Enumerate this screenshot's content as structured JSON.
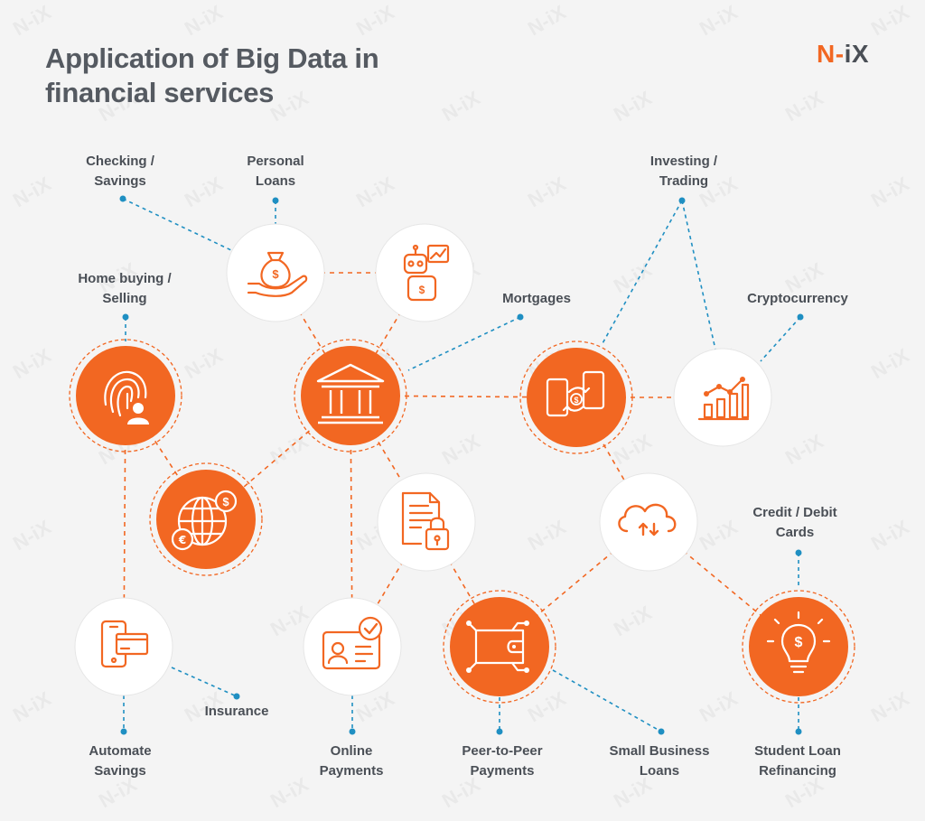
{
  "header": {
    "title_line1": "Application of Big Data in",
    "title_line2": "financial services",
    "logo_n": "N",
    "logo_dash": "-",
    "logo_ix": "iX"
  },
  "watermark": "N-iX",
  "colors": {
    "orange": "#f26722",
    "text": "#4a4f56",
    "blue_dot": "#1f8fc2",
    "white_node": "#ffffff",
    "background": "#f4f4f4"
  },
  "labels": {
    "checking": [
      "Checking /",
      "Savings"
    ],
    "personal_loans": [
      "Personal",
      "Loans"
    ],
    "investing": [
      "Investing /",
      "Trading"
    ],
    "home_buying": [
      "Home buying /",
      "Selling"
    ],
    "mortgages": [
      "Mortgages"
    ],
    "cryptocurrency": [
      "Cryptocurrency"
    ],
    "credit_debit": [
      "Credit / Debit",
      "Cards"
    ],
    "insurance": [
      "Insurance"
    ],
    "automate_savings": [
      "Automate",
      "Savings"
    ],
    "online_payments": [
      "Online",
      "Payments"
    ],
    "p2p": [
      "Peer-to-Peer",
      "Payments"
    ],
    "small_business": [
      "Small Business",
      "Loans"
    ],
    "student_loan": [
      "Student Loan",
      "Refinancing"
    ]
  },
  "nodes": [
    {
      "name": "money-bag-hand-icon",
      "style": "white"
    },
    {
      "name": "robot-advisor-icon",
      "style": "white"
    },
    {
      "name": "fingerprint-user-icon",
      "style": "orange"
    },
    {
      "name": "bank-building-icon",
      "style": "orange"
    },
    {
      "name": "phone-exchange-icon",
      "style": "orange"
    },
    {
      "name": "growth-chart-icon",
      "style": "white"
    },
    {
      "name": "globe-currency-icon",
      "style": "orange"
    },
    {
      "name": "secure-document-icon",
      "style": "white"
    },
    {
      "name": "cloud-sync-icon",
      "style": "white"
    },
    {
      "name": "mobile-card-icon",
      "style": "white"
    },
    {
      "name": "id-card-check-icon",
      "style": "white"
    },
    {
      "name": "digital-wallet-icon",
      "style": "orange"
    },
    {
      "name": "lightbulb-dollar-icon",
      "style": "orange"
    }
  ]
}
